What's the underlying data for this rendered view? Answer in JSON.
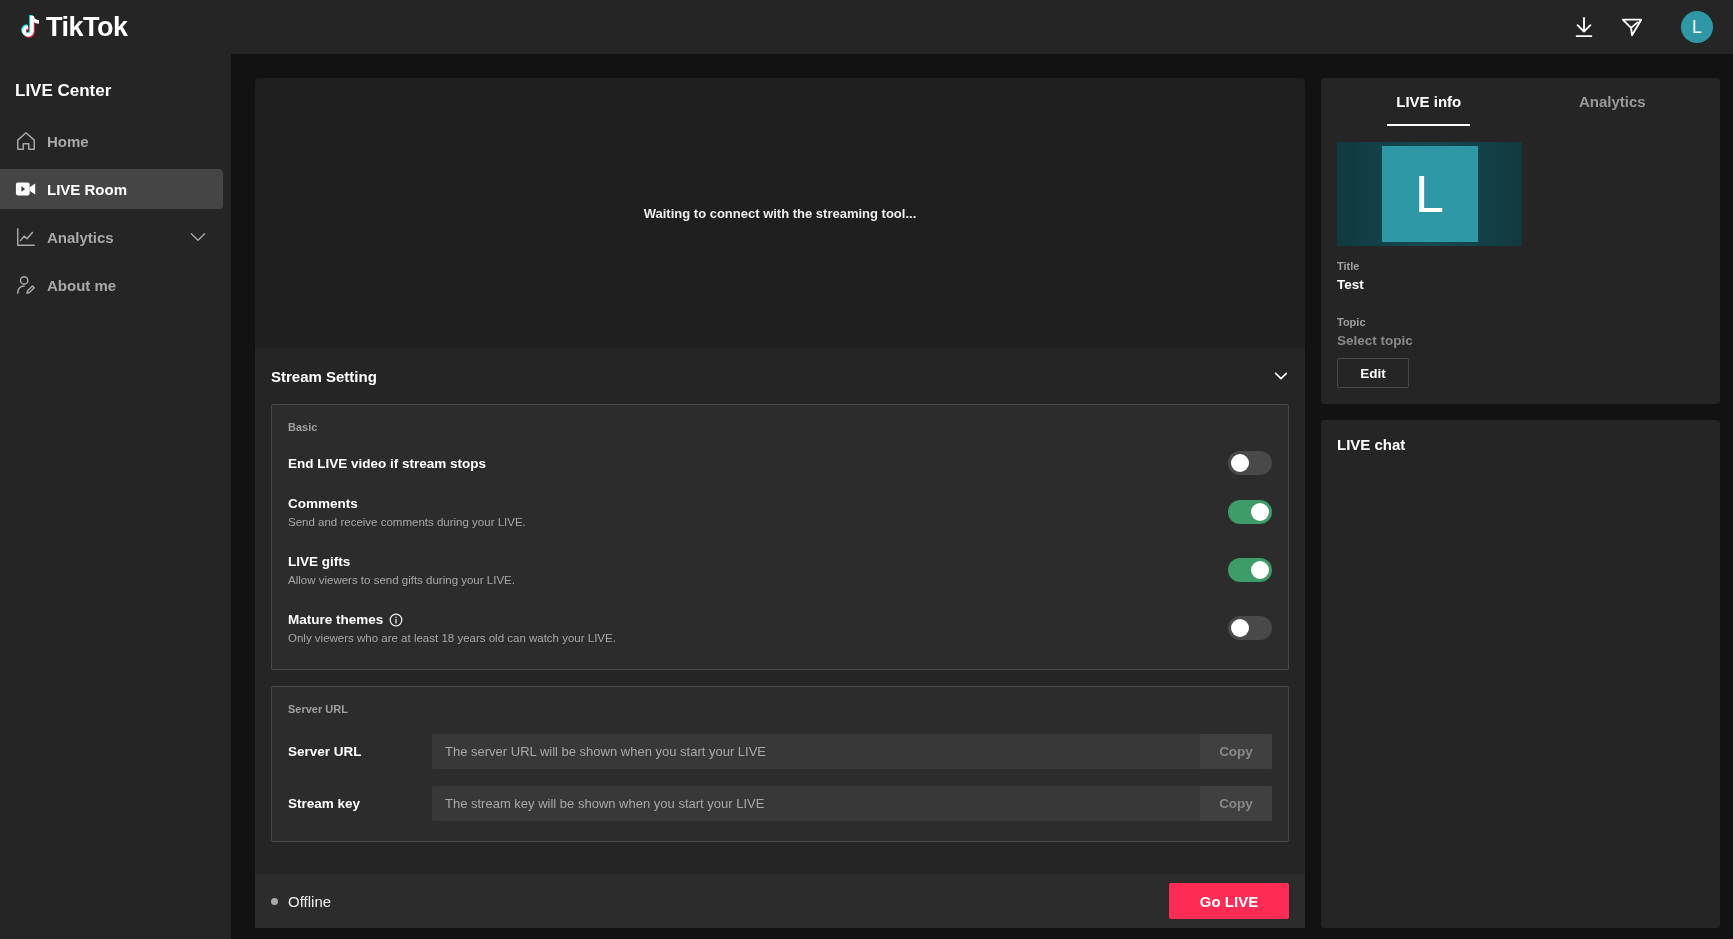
{
  "header": {
    "logo": "TikTok",
    "avatar": "L"
  },
  "sidebar": {
    "title": "LIVE Center",
    "items": [
      {
        "label": "Home",
        "kind": "home",
        "selected": false
      },
      {
        "label": "LIVE Room",
        "kind": "video",
        "selected": true
      },
      {
        "label": "Analytics",
        "kind": "chart",
        "selected": false,
        "expandable": true
      },
      {
        "label": "About me",
        "kind": "person",
        "selected": false
      }
    ]
  },
  "preview": {
    "message": "Waiting to connect with the streaming tool..."
  },
  "stream_setting": {
    "title": "Stream Setting",
    "expanded": true,
    "basic": {
      "heading": "Basic",
      "settings": [
        {
          "label": "End LIVE video if stream stops",
          "on": false
        },
        {
          "label": "Comments",
          "description": "Send and receive comments during your LIVE.",
          "on": true
        },
        {
          "label": "LIVE gifts",
          "description": "Allow viewers to send gifts during your LIVE.",
          "on": true
        },
        {
          "label": "Mature themes",
          "description": "Only viewers who are at least 18 years old can watch your LIVE.",
          "on": false,
          "info": true
        }
      ]
    },
    "server": {
      "heading": "Server URL",
      "fields": [
        {
          "label": "Server URL",
          "placeholder": "The server URL will be shown when you start your LIVE",
          "button": "Copy"
        },
        {
          "label": "Stream key",
          "placeholder": "The stream key will be shown when you start your LIVE",
          "button": "Copy"
        }
      ]
    }
  },
  "footer": {
    "status": "Offline",
    "button": "Go LIVE"
  },
  "info_panel": {
    "tabs": [
      {
        "label": "LIVE info",
        "selected": true
      },
      {
        "label": "Analytics",
        "selected": false
      }
    ],
    "cover_letter": "L",
    "title_label": "Title",
    "title": "Test",
    "topic_label": "Topic",
    "topic_placeholder": "Select topic",
    "edit_button": "Edit"
  },
  "chat": {
    "title": "LIVE chat"
  }
}
